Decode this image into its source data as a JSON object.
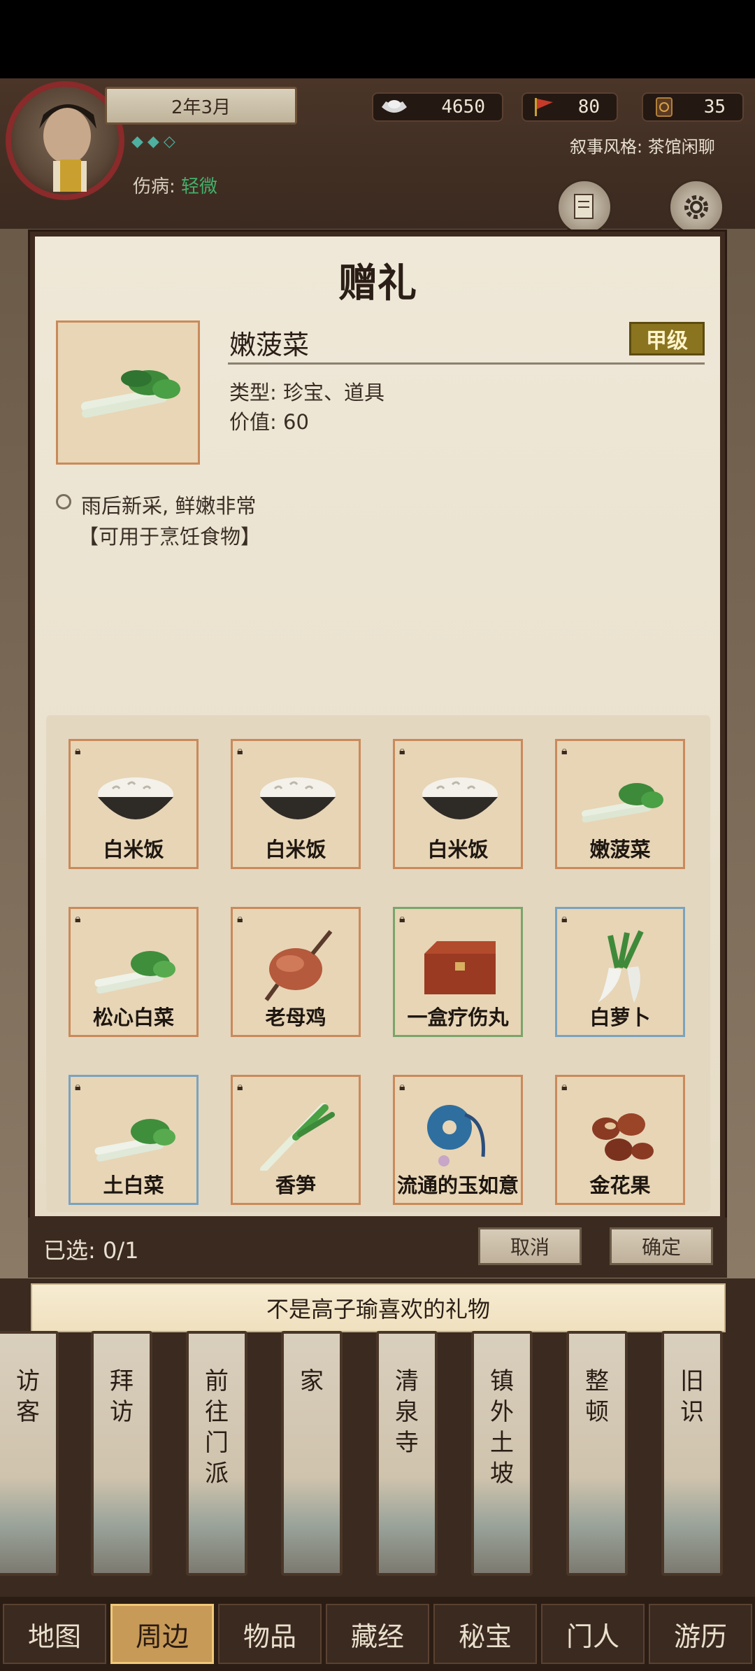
{
  "header": {
    "date": "2年3月",
    "diamonds": "◆◆◇",
    "injury_label": "伤病:",
    "injury_value": "轻微",
    "silver": "4650",
    "banner": "80",
    "coin": "35",
    "narrative_style": "叙事风格: 茶馆闲聊"
  },
  "dialog": {
    "title": "赠礼",
    "item": {
      "name": "嫩菠菜",
      "grade": "甲级",
      "type": "类型: 珍宝、道具",
      "value": "价值: 60",
      "desc": "雨后新采, 鲜嫩非常",
      "usage": "【可用于烹饪食物】"
    },
    "grid": [
      {
        "label": "白米饭",
        "icon": "rice-bowl",
        "border": "orange"
      },
      {
        "label": "白米饭",
        "icon": "rice-bowl",
        "border": "orange"
      },
      {
        "label": "白米饭",
        "icon": "rice-bowl",
        "border": "orange"
      },
      {
        "label": "嫩菠菜",
        "icon": "spinach",
        "border": "orange"
      },
      {
        "label": "松心白菜",
        "icon": "cabbage",
        "border": "orange"
      },
      {
        "label": "老母鸡",
        "icon": "roast-chicken",
        "border": "orange"
      },
      {
        "label": "一盒疗伤丸",
        "icon": "wooden-box",
        "border": "green"
      },
      {
        "label": "白萝卜",
        "icon": "radish",
        "border": "blue"
      },
      {
        "label": "土白菜",
        "icon": "cabbage",
        "border": "blue"
      },
      {
        "label": "香笋",
        "icon": "scallion",
        "border": "orange"
      },
      {
        "label": "流通的玉如意",
        "icon": "jade-pendant",
        "border": "orange"
      },
      {
        "label": "金花果",
        "icon": "nuts",
        "border": "orange"
      }
    ],
    "selected": "已选: 0/1",
    "cancel": "取消",
    "confirm": "确定"
  },
  "toast": "不是高子瑜喜欢的礼物",
  "locations": [
    "访客",
    "拜访",
    "前往门派",
    "家",
    "清泉寺",
    "镇外土坡",
    "整顿",
    "旧识"
  ],
  "tabs": [
    "地图",
    "周边",
    "物品",
    "藏经",
    "秘宝",
    "门人",
    "游历"
  ],
  "active_tab": "周边"
}
